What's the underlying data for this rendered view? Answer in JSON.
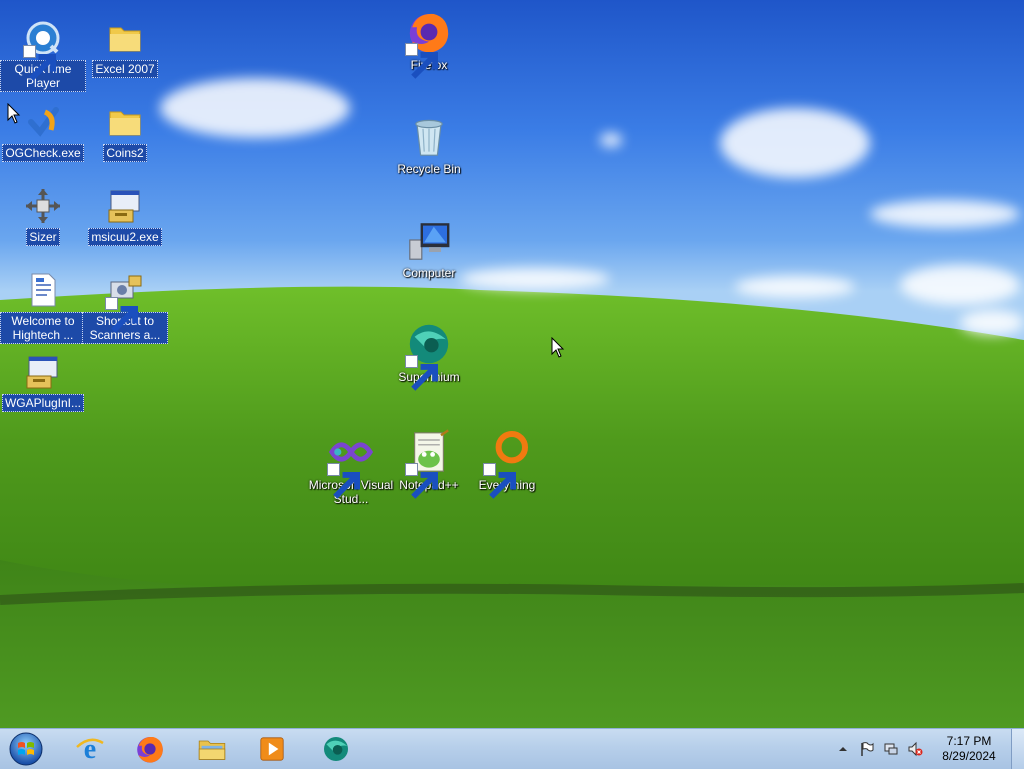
{
  "desktop": {
    "icons": [
      {
        "label": "QuickTime Player"
      },
      {
        "label": "Excel 2007"
      },
      {
        "label": "OGCheck.exe"
      },
      {
        "label": "Coins2"
      },
      {
        "label": "Sizer"
      },
      {
        "label": "msicuu2.exe"
      },
      {
        "label": "Welcome to Hightech ..."
      },
      {
        "label": "Shortcut to Scanners a..."
      },
      {
        "label": "WGAPlugInI..."
      },
      {
        "label": "Firefox"
      },
      {
        "label": "Recycle Bin"
      },
      {
        "label": "Computer"
      },
      {
        "label": "Supermium"
      },
      {
        "label": "Microsoft Visual Stud..."
      },
      {
        "label": "Notepad++"
      },
      {
        "label": "Everything"
      }
    ]
  },
  "taskbar": {
    "pinned": [
      "internet-explorer",
      "firefox",
      "file-explorer",
      "media-player",
      "supermium"
    ],
    "clock": {
      "time": "7:17 PM",
      "date": "8/29/2024"
    }
  },
  "colors": {
    "sky_top": "#1f56c9",
    "grass": "#4f9a1c",
    "selection": "#1d4aa8",
    "taskbar": "#b7cfea"
  }
}
